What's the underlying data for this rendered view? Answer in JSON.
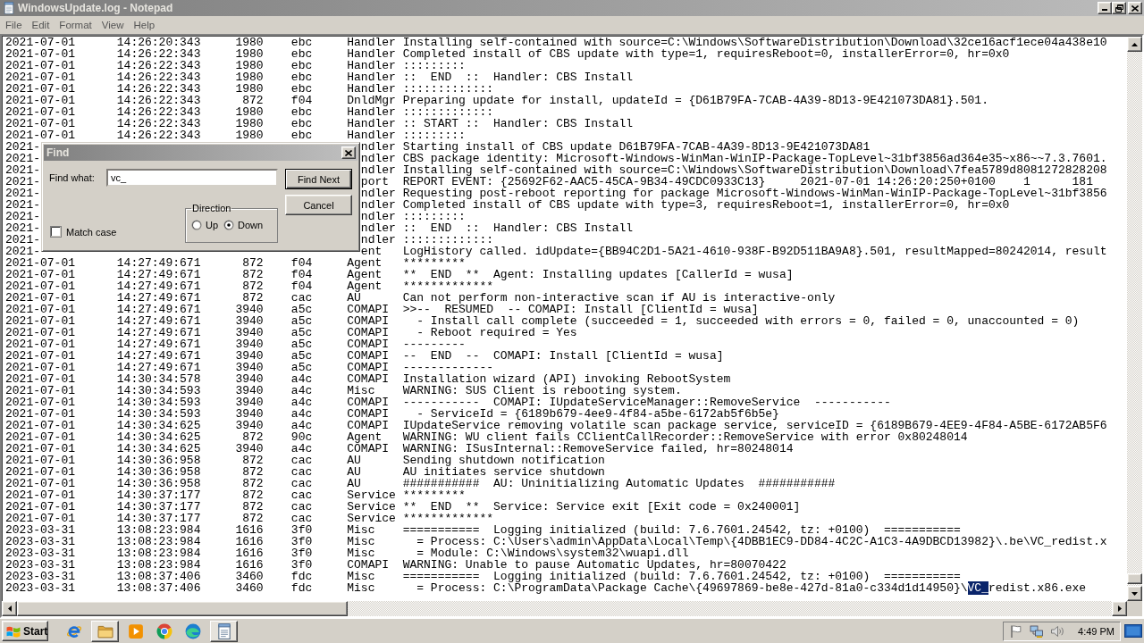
{
  "window": {
    "title": "WindowsUpdate.log - Notepad"
  },
  "menu": [
    "File",
    "Edit",
    "Format",
    "View",
    "Help"
  ],
  "log": {
    "rows": [
      {
        "date": "2021-07-01",
        "time": "14:26:20:343",
        "pid": "1980",
        "tid": "ebc",
        "component": "Handler",
        "message": "Installing self-contained with source=C:\\Windows\\SoftwareDistribution\\Download\\32ce16acf1ece04a438e10"
      },
      {
        "date": "2021-07-01",
        "time": "14:26:22:343",
        "pid": "1980",
        "tid": "ebc",
        "component": "Handler",
        "message": "Completed install of CBS update with type=1, requiresReboot=0, installerError=0, hr=0x0"
      },
      {
        "date": "2021-07-01",
        "time": "14:26:22:343",
        "pid": "1980",
        "tid": "ebc",
        "component": "Handler",
        "message": ":::::::::"
      },
      {
        "date": "2021-07-01",
        "time": "14:26:22:343",
        "pid": "1980",
        "tid": "ebc",
        "component": "Handler",
        "message": "::  END  ::  Handler: CBS Install"
      },
      {
        "date": "2021-07-01",
        "time": "14:26:22:343",
        "pid": "1980",
        "tid": "ebc",
        "component": "Handler",
        "message": ":::::::::::::"
      },
      {
        "date": "2021-07-01",
        "time": "14:26:22:343",
        "pid": "872",
        "tid": "f04",
        "component": "DnldMgr",
        "message": "Preparing update for install, updateId = {D61B79FA-7CAB-4A39-8D13-9E421073DA81}.501."
      },
      {
        "date": "2021-07-01",
        "time": "14:26:22:343",
        "pid": "1980",
        "tid": "ebc",
        "component": "Handler",
        "message": ":::::::::::::"
      },
      {
        "date": "2021-07-01",
        "time": "14:26:22:343",
        "pid": "1980",
        "tid": "ebc",
        "component": "Handler",
        "message": ":: START ::  Handler: CBS Install"
      },
      {
        "date": "2021-07-01",
        "time": "14:26:22:343",
        "pid": "1980",
        "tid": "ebc",
        "component": "Handler",
        "message": ":::::::::"
      },
      {
        "date": "2021-",
        "component": "ndler",
        "message": "Starting install of CBS update D61B79FA-7CAB-4A39-8D13-9E421073DA81"
      },
      {
        "date": "2021-",
        "component": "ndler",
        "message": "CBS package identity: Microsoft-Windows-WinMan-WinIP-Package-TopLevel~31bf3856ad364e35~x86~~7.3.7601."
      },
      {
        "date": "2021-",
        "component": "ndler",
        "message": "Installing self-contained with source=C:\\Windows\\SoftwareDistribution\\Download\\7fea5789d8081272828208"
      },
      {
        "date": "2021-",
        "component": "port",
        "message": "REPORT EVENT: {25692F62-AAC5-45CA-9B34-49CDC0933C13}     2021-07-01 14:26:20:250+0100    1      181"
      },
      {
        "date": "2021-",
        "component": "ndler",
        "message": "Requesting post-reboot reporting for package Microsoft-Windows-WinMan-WinIP-Package-TopLevel~31bf3856"
      },
      {
        "date": "2021-",
        "component": "ndler",
        "message": "Completed install of CBS update with type=3, requiresReboot=1, installerError=0, hr=0x0"
      },
      {
        "date": "2021-",
        "component": "ndler",
        "message": ":::::::::"
      },
      {
        "date": "2021-",
        "component": "ndler",
        "message": "::  END  ::  Handler: CBS Install"
      },
      {
        "date": "2021-",
        "component": "ndler",
        "message": ":::::::::::::"
      },
      {
        "date": "2021-",
        "component": "ent",
        "message": "LogHistory called. idUpdate={BB94C2D1-5A21-4610-938F-B92D511BA9A8}.501, resultMapped=80242014, result"
      },
      {
        "date": "2021-07-01",
        "time": "14:27:49:671",
        "pid": "872",
        "tid": "f04",
        "component": "Agent",
        "message": "*********"
      },
      {
        "date": "2021-07-01",
        "time": "14:27:49:671",
        "pid": "872",
        "tid": "f04",
        "component": "Agent",
        "message": "**  END  **  Agent: Installing updates [CallerId = wusa]"
      },
      {
        "date": "2021-07-01",
        "time": "14:27:49:671",
        "pid": "872",
        "tid": "f04",
        "component": "Agent",
        "message": "*************"
      },
      {
        "date": "2021-07-01",
        "time": "14:27:49:671",
        "pid": "872",
        "tid": "cac",
        "component": "AU",
        "message": "Can not perform non-interactive scan if AU is interactive-only"
      },
      {
        "date": "2021-07-01",
        "time": "14:27:49:671",
        "pid": "3940",
        "tid": "a5c",
        "component": "COMAPI",
        "message": ">>--  RESUMED  -- COMAPI: Install [ClientId = wusa]"
      },
      {
        "date": "2021-07-01",
        "time": "14:27:49:671",
        "pid": "3940",
        "tid": "a5c",
        "component": "COMAPI",
        "message": "  - Install call complete (succeeded = 1, succeeded with errors = 0, failed = 0, unaccounted = 0)"
      },
      {
        "date": "2021-07-01",
        "time": "14:27:49:671",
        "pid": "3940",
        "tid": "a5c",
        "component": "COMAPI",
        "message": "  - Reboot required = Yes"
      },
      {
        "date": "2021-07-01",
        "time": "14:27:49:671",
        "pid": "3940",
        "tid": "a5c",
        "component": "COMAPI",
        "message": "---------"
      },
      {
        "date": "2021-07-01",
        "time": "14:27:49:671",
        "pid": "3940",
        "tid": "a5c",
        "component": "COMAPI",
        "message": "--  END  --  COMAPI: Install [ClientId = wusa]"
      },
      {
        "date": "2021-07-01",
        "time": "14:27:49:671",
        "pid": "3940",
        "tid": "a5c",
        "component": "COMAPI",
        "message": "-------------"
      },
      {
        "date": "2021-07-01",
        "time": "14:30:34:578",
        "pid": "3940",
        "tid": "a4c",
        "component": "COMAPI",
        "message": "Installation wizard (API) invoking RebootSystem"
      },
      {
        "date": "2021-07-01",
        "time": "14:30:34:593",
        "pid": "3940",
        "tid": "a4c",
        "component": "Misc",
        "message": "WARNING: SUS Client is rebooting system."
      },
      {
        "date": "2021-07-01",
        "time": "14:30:34:593",
        "pid": "3940",
        "tid": "a4c",
        "component": "COMAPI",
        "message": "-----------  COMAPI: IUpdateServiceManager::RemoveService  -----------"
      },
      {
        "date": "2021-07-01",
        "time": "14:30:34:593",
        "pid": "3940",
        "tid": "a4c",
        "component": "COMAPI",
        "message": "  - ServiceId = {6189b679-4ee9-4f84-a5be-6172ab5f6b5e}"
      },
      {
        "date": "2021-07-01",
        "time": "14:30:34:625",
        "pid": "3940",
        "tid": "a4c",
        "component": "COMAPI",
        "message": "IUpdateService removing volatile scan package service, serviceID = {6189B679-4EE9-4F84-A5BE-6172AB5F6"
      },
      {
        "date": "2021-07-01",
        "time": "14:30:34:625",
        "pid": "872",
        "tid": "90c",
        "component": "Agent",
        "message": "WARNING: WU client fails CClientCallRecorder::RemoveService with error 0x80248014"
      },
      {
        "date": "2021-07-01",
        "time": "14:30:34:625",
        "pid": "3940",
        "tid": "a4c",
        "component": "COMAPI",
        "message": "WARNING: ISusInternal::RemoveService failed, hr=80248014"
      },
      {
        "date": "2021-07-01",
        "time": "14:30:36:958",
        "pid": "872",
        "tid": "cac",
        "component": "AU",
        "message": "Sending shutdown notification"
      },
      {
        "date": "2021-07-01",
        "time": "14:30:36:958",
        "pid": "872",
        "tid": "cac",
        "component": "AU",
        "message": "AU initiates service shutdown"
      },
      {
        "date": "2021-07-01",
        "time": "14:30:36:958",
        "pid": "872",
        "tid": "cac",
        "component": "AU",
        "message": "###########  AU: Uninitializing Automatic Updates  ###########"
      },
      {
        "date": "2021-07-01",
        "time": "14:30:37:177",
        "pid": "872",
        "tid": "cac",
        "component": "Service",
        "message": "*********"
      },
      {
        "date": "2021-07-01",
        "time": "14:30:37:177",
        "pid": "872",
        "tid": "cac",
        "component": "Service",
        "message": "**  END  **  Service: Service exit [Exit code = 0x240001]"
      },
      {
        "date": "2021-07-01",
        "time": "14:30:37:177",
        "pid": "872",
        "tid": "cac",
        "component": "Service",
        "message": "*************"
      },
      {
        "date": "2023-03-31",
        "time": "13:08:23:984",
        "pid": "1616",
        "tid": "3f0",
        "component": "Misc",
        "message": "===========  Logging initialized (build: 7.6.7601.24542, tz: +0100)  ==========="
      },
      {
        "date": "2023-03-31",
        "time": "13:08:23:984",
        "pid": "1616",
        "tid": "3f0",
        "component": "Misc",
        "message": "  = Process: C:\\Users\\admin\\AppData\\Local\\Temp\\{4DBB1EC9-DD84-4C2C-A1C3-4A9DBCD13982}\\.be\\VC_redist.x"
      },
      {
        "date": "2023-03-31",
        "time": "13:08:23:984",
        "pid": "1616",
        "tid": "3f0",
        "component": "Misc",
        "message": "  = Module: C:\\Windows\\system32\\wuapi.dll"
      },
      {
        "date": "2023-03-31",
        "time": "13:08:23:984",
        "pid": "1616",
        "tid": "3f0",
        "component": "COMAPI",
        "message": "WARNING: Unable to pause Automatic Updates, hr=80070422"
      },
      {
        "date": "2023-03-31",
        "time": "13:08:37:406",
        "pid": "3460",
        "tid": "fdc",
        "component": "Misc",
        "message": "===========  Logging initialized (build: 7.6.7601.24542, tz: +0100)  ==========="
      },
      {
        "date": "2023-03-31",
        "time": "13:08:37:406",
        "pid": "3460",
        "tid": "fdc",
        "component": "Misc",
        "message_parts": [
          {
            "text": "  = Process: C:\\ProgramData\\Package Cache\\{49697869-be8e-427d-81a0-c334d1d14950}\\",
            "selected": false
          },
          {
            "text": "VC_",
            "selected": true
          },
          {
            "text": "redist.x86.exe",
            "selected": false
          }
        ]
      }
    ]
  },
  "find_dialog": {
    "title": "Find",
    "find_what": {
      "label": "Find what:",
      "value": "vc_"
    },
    "buttons": [
      {
        "label": "Find Next",
        "default": true
      },
      {
        "label": "Cancel",
        "default": false
      }
    ],
    "direction": {
      "label": "Direction",
      "options": [
        {
          "label": "Up",
          "selected": false
        },
        {
          "label": "Down",
          "selected": true
        }
      ]
    },
    "match_case": {
      "label": "Match case",
      "checked": false
    }
  },
  "taskbar": {
    "start": "Start",
    "items": [
      {
        "kind": "e-browser",
        "open": false
      },
      {
        "kind": "folder",
        "open": true
      },
      {
        "kind": "player",
        "open": false
      },
      {
        "kind": "round-browser",
        "open": false
      },
      {
        "kind": "wave-browser",
        "open": false
      },
      {
        "kind": "notepad",
        "open": true
      }
    ],
    "clock": "4:49 PM"
  }
}
